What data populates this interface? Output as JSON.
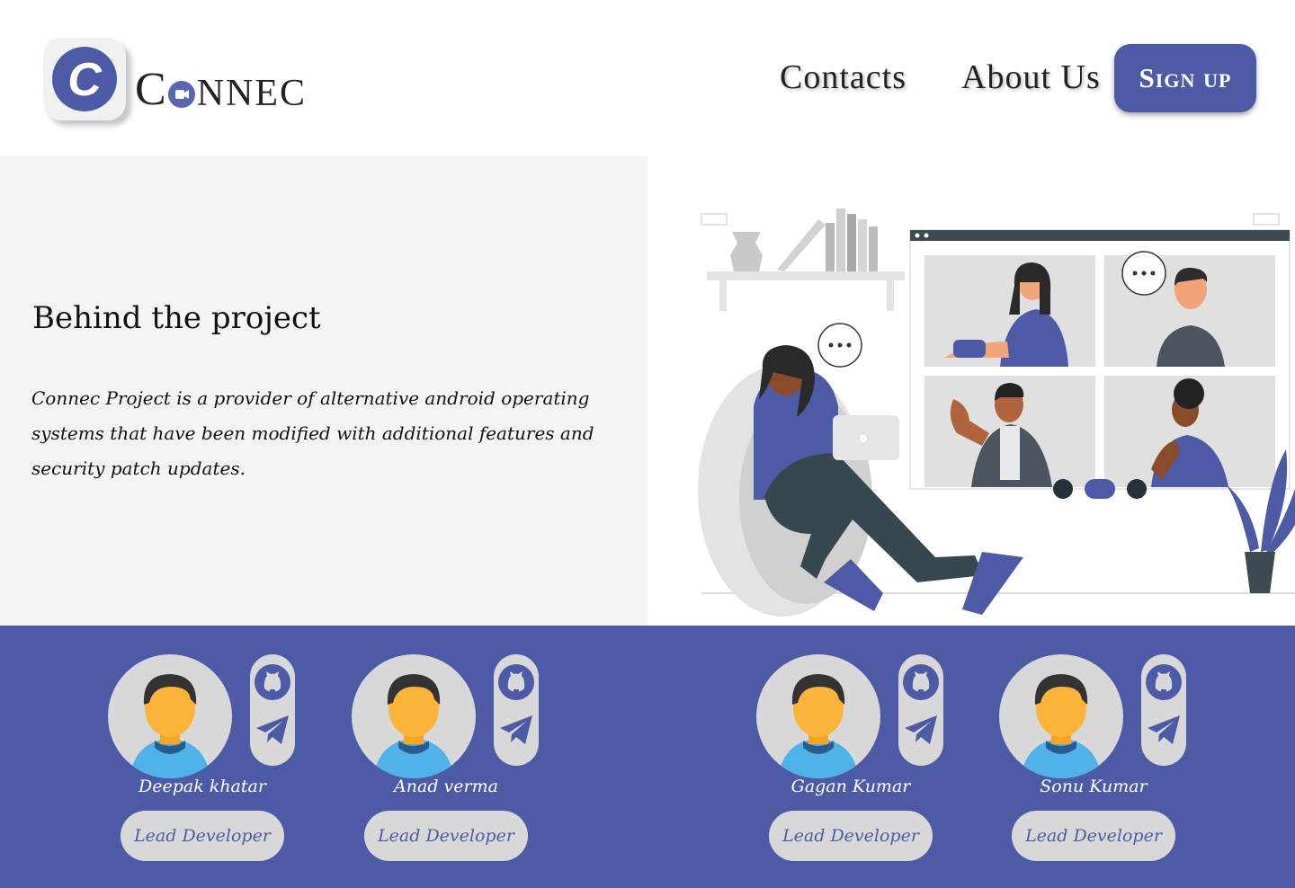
{
  "brand": {
    "logo_letter": "C",
    "first_letter": "C",
    "rest": "NNEC"
  },
  "nav": {
    "contacts": "Contacts",
    "about": "About Us",
    "signup": "Sign up"
  },
  "hero": {
    "title": "Behind the project",
    "description": "Connec Project  is a provider of alternative android operating systems that have been modified with additional features and security patch updates."
  },
  "team": [
    {
      "name": "Deepak khatar",
      "role": "Lead Developer"
    },
    {
      "name": "Anad verma",
      "role": "Lead Developer"
    },
    {
      "name": "Gagan Kumar",
      "role": "Lead Developer"
    },
    {
      "name": "Sonu Kumar",
      "role": "Lead Developer"
    }
  ],
  "icons": {
    "social": [
      "github-icon",
      "telegram-icon"
    ],
    "call_controls": [
      "video-icon",
      "hangup-icon",
      "mic-icon"
    ]
  },
  "colors": {
    "accent": "#4d5ba6",
    "panel": "#f4f4f4",
    "avatar_bg": "#d8d8d8"
  }
}
